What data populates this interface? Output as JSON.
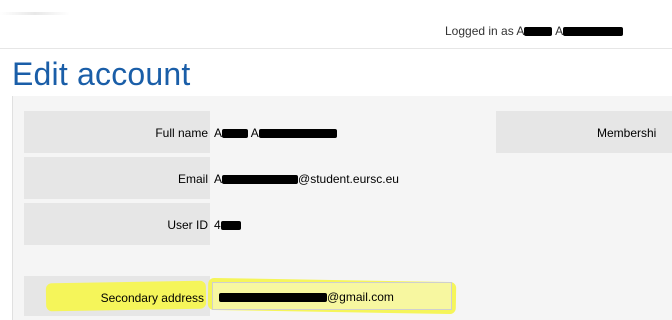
{
  "header": {
    "logged_in_prefix": "Logged in as",
    "user_first_initial": "A",
    "user_second_initial": "A"
  },
  "page": {
    "title": "Edit account"
  },
  "account": {
    "full_name_label": "Full name",
    "full_name_first_initial": "A",
    "full_name_second_initial": "A",
    "email_label": "Email",
    "email_first_initial": "A",
    "email_domain": "@student.eursc.eu",
    "user_id_label": "User ID",
    "user_id_prefix": "4",
    "membership_label": "Membershi",
    "secondary_address_label": "Secondary address",
    "secondary_address_domain": "@gmail.com"
  }
}
